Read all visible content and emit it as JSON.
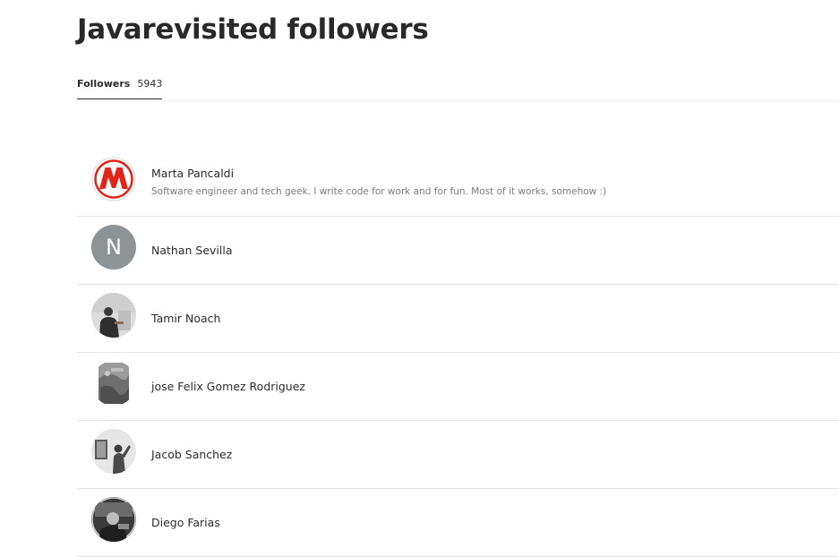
{
  "page": {
    "title": "Javarevisited followers"
  },
  "tabs": [
    {
      "label": "Followers",
      "count": "5943"
    }
  ],
  "followers": [
    {
      "name": "Marta Pancaldi",
      "bio": "Software engineer and tech geek. I write code for work and for fun. Most of it works, somehow :)",
      "avatar": "mario-m-logo-avatar"
    },
    {
      "name": "Nathan Sevilla",
      "initial": "N",
      "avatar": "initial-avatar"
    },
    {
      "name": "Tamir Noach",
      "avatar": "photo-avatar"
    },
    {
      "name": "jose Felix Gomez Rodriguez",
      "avatar": "photo-avatar"
    },
    {
      "name": "Jacob Sanchez",
      "avatar": "photo-avatar"
    },
    {
      "name": "Diego Farias",
      "avatar": "photo-avatar"
    }
  ]
}
